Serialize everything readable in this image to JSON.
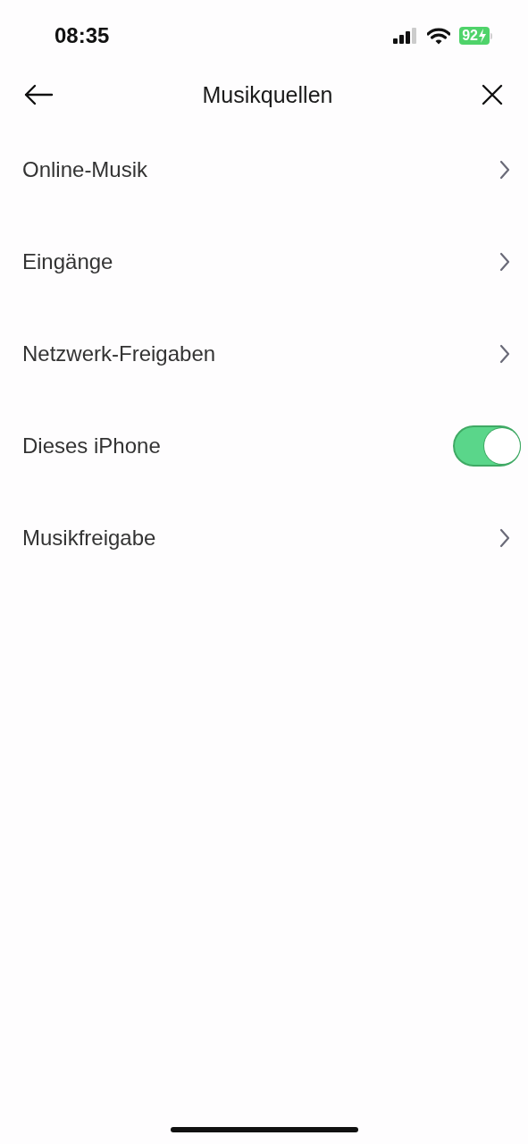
{
  "status_bar": {
    "time": "08:35",
    "battery": "92"
  },
  "header": {
    "title": "Musikquellen"
  },
  "items": [
    {
      "label": "Online-Musik",
      "kind": "link"
    },
    {
      "label": "Eingänge",
      "kind": "link"
    },
    {
      "label": "Netzwerk-Freigaben",
      "kind": "link"
    },
    {
      "label": "Dieses iPhone",
      "kind": "toggle",
      "on": true
    },
    {
      "label": "Musikfreigabe",
      "kind": "link"
    }
  ]
}
